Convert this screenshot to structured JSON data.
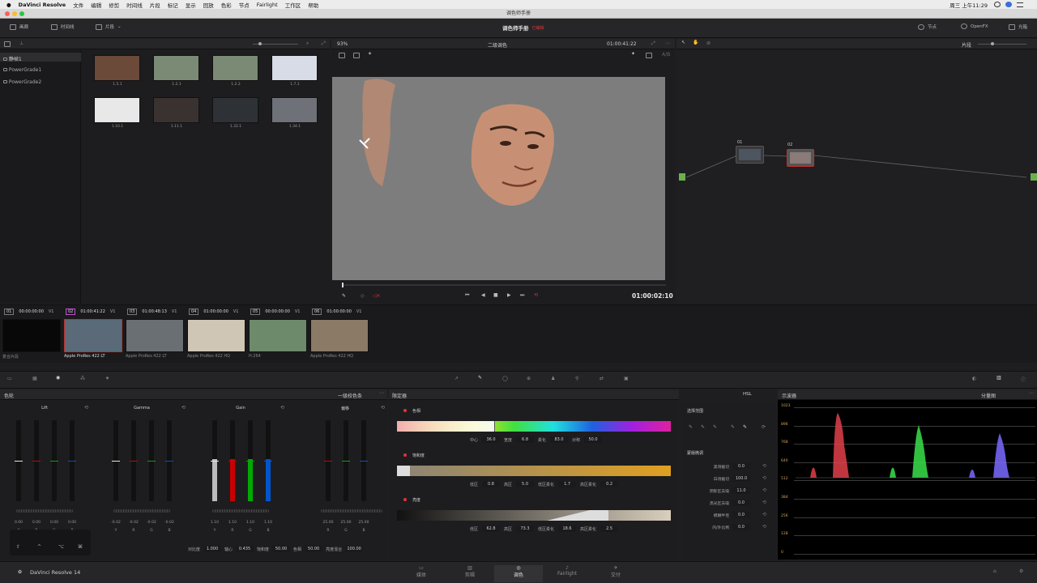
{
  "menubar": {
    "app": "DaVinci Resolve",
    "items": [
      "文件",
      "编辑",
      "修剪",
      "时间线",
      "片段",
      "标记",
      "显示",
      "回放",
      "色彩",
      "节点",
      "Fairlight",
      "工作区",
      "帮助"
    ],
    "datetime": "周三 上午11:29"
  },
  "window": {
    "title": "调色师手册"
  },
  "toolbar": {
    "gallery": "画廊",
    "timeline": "时间线",
    "clips": "片段",
    "project_title": "调色师手册",
    "edited_status": "已编辑",
    "nodes": "节点",
    "openfx": "OpenFX",
    "lightbox": "光箱"
  },
  "gallery": {
    "albums": [
      "静帧1",
      "PowerGrade1",
      "PowerGrade2"
    ],
    "stills": [
      {
        "label": "1.5.1",
        "color": "#6b4a3a"
      },
      {
        "label": "1.2.1",
        "color": "#7a8a74"
      },
      {
        "label": "1.2.2",
        "color": "#7a8a74"
      },
      {
        "label": "1.7.1",
        "color": "#d8dce6"
      },
      {
        "label": "1.10.1",
        "color": "#e8e8e8"
      },
      {
        "label": "1.11.1",
        "color": "#3a3230"
      },
      {
        "label": "1.32.1",
        "color": "#2e3236"
      },
      {
        "label": "1.34.1",
        "color": "#6e7278"
      }
    ]
  },
  "viewer": {
    "zoom": "93%",
    "mode": "二级调色",
    "timecode": "01:00:41:22",
    "playhead_tc": "01:00:02:10"
  },
  "node_editor": {
    "clip_mode": "片段",
    "node1": "01",
    "node2": "02"
  },
  "clips": [
    {
      "num": "01",
      "tc": "00:00:00:00",
      "track": "V1",
      "codec": "复合片段",
      "color": "#080808"
    },
    {
      "num": "02",
      "tc": "01:00:41:22",
      "track": "V1",
      "codec": "Apple ProRes 422 LT",
      "color": "#5a6a78"
    },
    {
      "num": "03",
      "tc": "01:00:48:13",
      "track": "V1",
      "codec": "Apple ProRes 422 LT",
      "color": "#6a6f74"
    },
    {
      "num": "04",
      "tc": "01:00:00:00",
      "track": "V1",
      "codec": "Apple ProRes 422 HQ",
      "color": "#cfc6b6"
    },
    {
      "num": "05",
      "tc": "00:00:00:00",
      "track": "V1",
      "codec": "H.264",
      "color": "#6d8a6a"
    },
    {
      "num": "06",
      "tc": "01:00:00:00",
      "track": "V1",
      "codec": "Apple ProRes 422 HQ",
      "color": "#8a7a66"
    }
  ],
  "color_wheels": {
    "title": "色轮",
    "mode": "一级校色条",
    "groups": [
      {
        "name": "Lift",
        "values": [
          "0.00",
          "0.00",
          "0.00",
          "0.00"
        ]
      },
      {
        "name": "Gamma",
        "values": [
          "-0.02",
          "-0.02",
          "-0.02",
          "-0.02"
        ]
      },
      {
        "name": "Gain",
        "values": [
          "1.10",
          "1.10",
          "1.10",
          "1.10"
        ]
      },
      {
        "name": "偏移",
        "values": [
          "25.00",
          "25.00",
          "25.00"
        ]
      }
    ],
    "channels4": [
      "Y",
      "R",
      "G",
      "B"
    ],
    "channels3": [
      "R",
      "G",
      "B"
    ],
    "bottom": {
      "contrast_label": "对比度",
      "contrast": "1.000",
      "pivot_label": "轴心",
      "pivot": "0.435",
      "sat_label": "饱和度",
      "sat": "50.00",
      "hue_label": "色相",
      "hue": "50.00",
      "lummix_label": "亮度混合",
      "lummix": "100.00"
    }
  },
  "qualifier": {
    "title": "限定器",
    "mode": "HSL",
    "hue": {
      "label": "色相",
      "center_l": "中心",
      "center": "36.0",
      "width_l": "宽度",
      "width": "6.8",
      "soft_l": "柔化",
      "soft": "83.0",
      "sym_l": "对称",
      "sym": "50.0"
    },
    "sat": {
      "label": "饱和度",
      "low_l": "低区",
      "low": "0.8",
      "high_l": "高区",
      "high": "5.0",
      "lowsoft_l": "低区柔化",
      "lowsoft": "1.7",
      "highsoft_l": "高区柔化",
      "highsoft": "0.2"
    },
    "lum": {
      "label": "亮度",
      "low_l": "低区",
      "low": "62.8",
      "high_l": "高区",
      "high": "73.3",
      "lowsoft_l": "低区柔化",
      "lowsoft": "18.6",
      "highsoft_l": "高区柔化",
      "highsoft": "2.5"
    }
  },
  "selection": {
    "title": "选择范围",
    "matte_title": "蒙版微调",
    "rows": [
      {
        "label": "黑场截切",
        "value": "0.0"
      },
      {
        "label": "白场截切",
        "value": "100.0"
      },
      {
        "label": "阴影区去噪",
        "value": "11.0"
      },
      {
        "label": "高光区去噪",
        "value": "0.0"
      },
      {
        "label": "模糊半径",
        "value": "0.0"
      },
      {
        "label": "内/外比例",
        "value": "0.0"
      }
    ]
  },
  "scope": {
    "title": "示波器",
    "mode": "分量图",
    "ticks": [
      "1023",
      "896",
      "768",
      "640",
      "512",
      "384",
      "256",
      "128",
      "0"
    ]
  },
  "app_footer": "DaVinci Resolve 14",
  "pages": [
    "媒体",
    "剪辑",
    "调色",
    "Fairlight",
    "交付"
  ],
  "colors": {
    "accent_red": "#e0343a",
    "selected": "#c23030",
    "panel": "#1d1d1f"
  }
}
